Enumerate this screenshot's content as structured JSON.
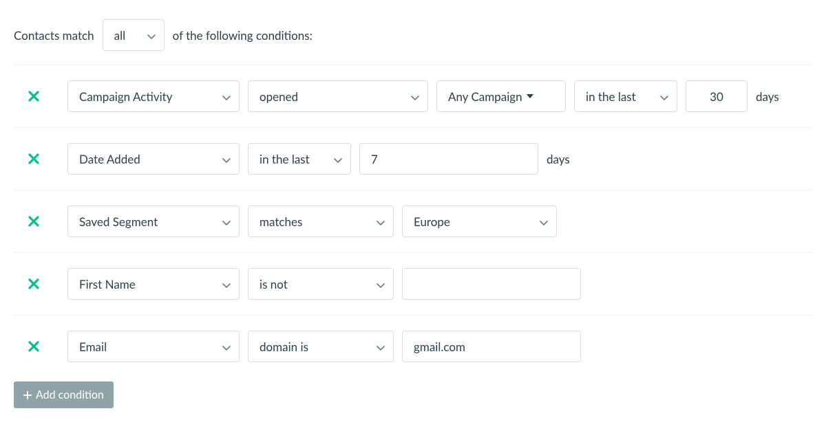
{
  "header": {
    "prefix": "Contacts match",
    "match_mode": "all",
    "suffix": "of the following conditions:"
  },
  "conditions": [
    {
      "field": "Campaign Activity",
      "op": "opened",
      "campaign": "Any Campaign",
      "range": "in the last",
      "value": "30",
      "unit": "days"
    },
    {
      "field": "Date Added",
      "range": "in the last",
      "value": "7",
      "unit": "days"
    },
    {
      "field": "Saved Segment",
      "op": "matches",
      "segment": "Europe"
    },
    {
      "field": "First Name",
      "op": "is not",
      "value": ""
    },
    {
      "field": "Email",
      "op": "domain is",
      "value": "gmail.com"
    }
  ],
  "add_button": "Add condition"
}
